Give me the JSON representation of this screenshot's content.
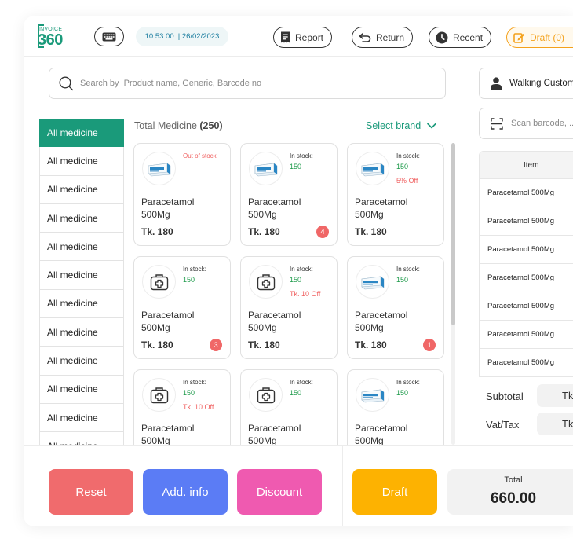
{
  "header": {
    "logo_top": "INVOICE",
    "logo_num": "360",
    "datetime": "10:53:00 || 26/02/2023",
    "report": "Report",
    "return": "Return",
    "recent": "Recent",
    "draft": "Draft (0)"
  },
  "search": {
    "placeholder": "Search by  Product name, Generic, Barcode no"
  },
  "categories": [
    "All medicine",
    "All medicine",
    "All medicine",
    "All medicine",
    "All medicine",
    "All medicine",
    "All medicine",
    "All medicine",
    "All medicine",
    "All medicine",
    "All medicine",
    "All medicine"
  ],
  "grid": {
    "title": "Total Medicine",
    "count": "(250)",
    "select_brand": "Select brand"
  },
  "products": [
    {
      "stock_label": "Out of stock",
      "stock_value": "",
      "offer": "",
      "name": "Paracetamol 500Mg",
      "price": "Tk. 180",
      "qty": "",
      "image": "medicine-box"
    },
    {
      "stock_label": "In stock:",
      "stock_value": "150",
      "offer": "",
      "name": "Paracetamol 500Mg",
      "price": "Tk. 180",
      "qty": "4",
      "image": "medicine-box"
    },
    {
      "stock_label": "In stock:",
      "stock_value": "150",
      "offer": "5% Off",
      "name": "Paracetamol 500Mg",
      "price": "Tk. 180",
      "qty": "",
      "image": "medicine-box"
    },
    {
      "stock_label": "In stock:",
      "stock_value": "150",
      "offer": "",
      "name": "Paracetamol 500Mg",
      "price": "Tk. 180",
      "qty": "3",
      "image": "medical-kit"
    },
    {
      "stock_label": "In stock:",
      "stock_value": "150",
      "offer": "Tk. 10 Off",
      "name": "Paracetamol 500Mg",
      "price": "Tk. 180",
      "qty": "",
      "image": "medical-kit"
    },
    {
      "stock_label": "In stock:",
      "stock_value": "150",
      "offer": "",
      "name": "Paracetamol 500Mg",
      "price": "Tk. 180",
      "qty": "1",
      "image": "medicine-box"
    },
    {
      "stock_label": "In stock:",
      "stock_value": "150",
      "offer": "Tk. 10 Off",
      "name": "Paracetamol 500Mg",
      "price": "",
      "qty": "",
      "image": "medical-kit"
    },
    {
      "stock_label": "In stock:",
      "stock_value": "150",
      "offer": "",
      "name": "Paracetamol 500Mg",
      "price": "",
      "qty": "",
      "image": "medical-kit"
    },
    {
      "stock_label": "In stock:",
      "stock_value": "150",
      "offer": "",
      "name": "Paracetamol 500Mg",
      "price": "",
      "qty": "",
      "image": "medicine-box"
    }
  ],
  "right": {
    "customer": "Walking Customer",
    "scan_placeholder": "Scan barcode, ...",
    "table_header": "Item",
    "rows": [
      "Paracetamol 500Mg",
      "Paracetamol 500Mg",
      "Paracetamol 500Mg",
      "Paracetamol 500Mg",
      "Paracetamol 500Mg",
      "Paracetamol 500Mg",
      "Paracetamol 500Mg"
    ],
    "subtotal_label": "Subtotal",
    "subtotal_value": "Tk",
    "vat_label": "Vat/Tax",
    "vat_value": "Tk"
  },
  "bottom": {
    "reset": "Reset",
    "add_info": "Add. info",
    "discount": "Discount",
    "draft": "Draft",
    "total_label": "Total",
    "total_value": "660.00"
  },
  "colors": {
    "brand": "#1a9a7a",
    "reset": "#f06b6d",
    "add_info": "#5b7cf5",
    "discount": "#ef5ab0",
    "draft": "#fdb201",
    "badge": "#f06767"
  }
}
